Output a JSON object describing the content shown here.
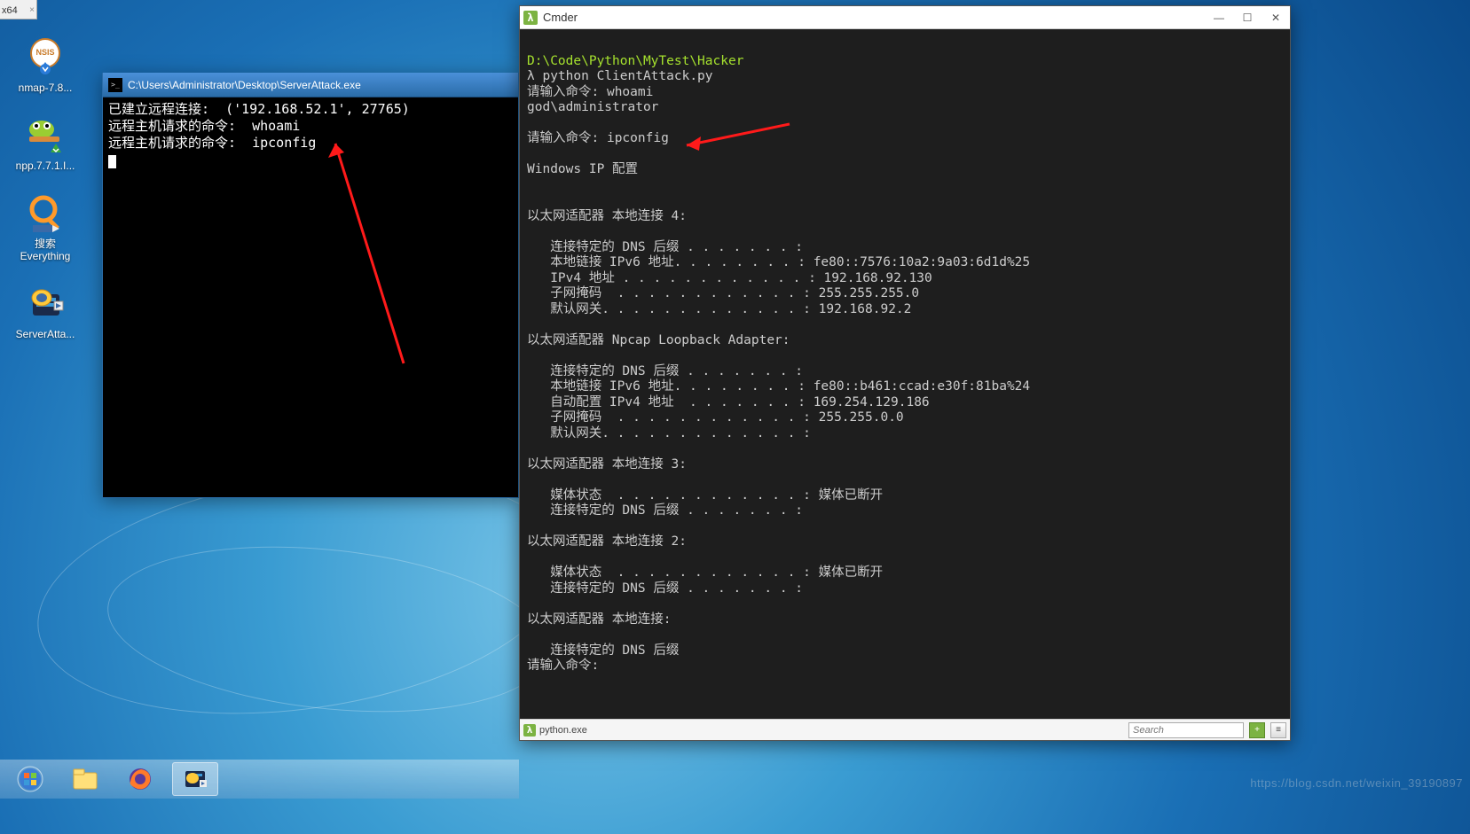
{
  "top_tab": {
    "label": "x64",
    "close": "×"
  },
  "desktop": {
    "icons": [
      {
        "name": "nmap",
        "label": "nmap-7.8..."
      },
      {
        "name": "npp",
        "label": "npp.7.7.1.I..."
      },
      {
        "name": "everything",
        "label_line1": "搜索",
        "label_line2": "Everything"
      },
      {
        "name": "serveratta",
        "label": "ServerAtta..."
      }
    ]
  },
  "server_window": {
    "title": "C:\\Users\\Administrator\\Desktop\\ServerAttack.exe",
    "line1": "已建立远程连接:  ('192.168.52.1', 27765)",
    "line2": "远程主机请求的命令:  whoami",
    "line3": "远程主机请求的命令:  ipconfig"
  },
  "cmder": {
    "title": "Cmder",
    "path": "D:\\Code\\Python\\MyTest\\Hacker",
    "prompt_cmd": "λ python ClientAttack.py",
    "input1_label": "请输入命令: ",
    "input1_value": "whoami",
    "whoami_result": "god\\administrator",
    "input2_label": "请输入命令: ",
    "input2_value": "ipconfig",
    "ipcfg_header": "Windows IP 配置",
    "adapter4_title": "以太网适配器 本地连接 4:",
    "adapter4_dns": "   连接特定的 DNS 后缀 . . . . . . . :",
    "adapter4_ipv6": "   本地链接 IPv6 地址. . . . . . . . : fe80::7576:10a2:9a03:6d1d%25",
    "adapter4_ipv4": "   IPv4 地址 . . . . . . . . . . . . : 192.168.92.130",
    "adapter4_mask": "   子网掩码  . . . . . . . . . . . . : 255.255.255.0",
    "adapter4_gw": "   默认网关. . . . . . . . . . . . . : 192.168.92.2",
    "adapter_np_title": "以太网适配器 Npcap Loopback Adapter:",
    "adapter_np_dns": "   连接特定的 DNS 后缀 . . . . . . . :",
    "adapter_np_ipv6": "   本地链接 IPv6 地址. . . . . . . . : fe80::b461:ccad:e30f:81ba%24",
    "adapter_np_ipv4": "   自动配置 IPv4 地址  . . . . . . . : 169.254.129.186",
    "adapter_np_mask": "   子网掩码  . . . . . . . . . . . . : 255.255.0.0",
    "adapter_np_gw": "   默认网关. . . . . . . . . . . . . :",
    "adapter3_title": "以太网适配器 本地连接 3:",
    "adapter3_media": "   媒体状态  . . . . . . . . . . . . : 媒体已断开",
    "adapter3_dns": "   连接特定的 DNS 后缀 . . . . . . . :",
    "adapter2_title": "以太网适配器 本地连接 2:",
    "adapter2_media": "   媒体状态  . . . . . . . . . . . . : 媒体已断开",
    "adapter2_dns": "   连接特定的 DNS 后缀 . . . . . . . :",
    "adapter_local_title": "以太网适配器 本地连接:",
    "adapter_local_dns": "   连接特定的 DNS 后缀",
    "input3_label": "请输入命令: ",
    "statusbar": {
      "tab_label": "python.exe",
      "search_placeholder": "Search",
      "add": "+",
      "menu": "≡"
    }
  },
  "watermark": "https://blog.csdn.net/weixin_39190897"
}
